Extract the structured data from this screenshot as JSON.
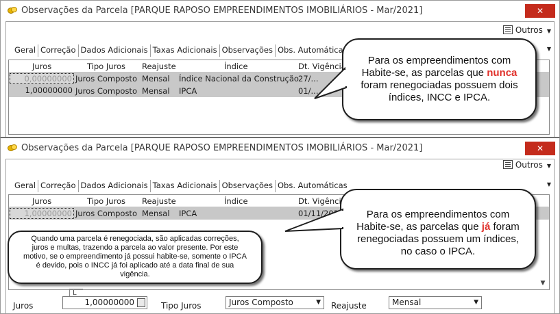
{
  "window1": {
    "title": "Observações da Parcela [PARQUE RAPOSO EMPREENDIMENTOS IMOBILIÁRIOS - Mar/2021]",
    "close_label": "✕",
    "outros_label": "Outros",
    "tabs": [
      "Geral",
      "Correção",
      "Dados Adicionais",
      "Taxas Adicionais",
      "Observações",
      "Obs. Automáticas"
    ],
    "active_tab": "Correção",
    "columns": [
      "Juros",
      "Tipo Juros",
      "Reajuste",
      "Índice",
      "Dt. Vigência"
    ],
    "rows": [
      {
        "juros": "0,00000000",
        "tipo_juros": "Juros Composto",
        "reajuste": "Mensal",
        "indice": "Índice Nacional da Construção",
        "vigencia": "27/..."
      },
      {
        "juros": "1,00000000",
        "tipo_juros": "Juros Composto",
        "reajuste": "Mensal",
        "indice": "IPCA",
        "vigencia": "01/..."
      }
    ]
  },
  "window2": {
    "title": "Observações da Parcela [PARQUE RAPOSO EMPREENDIMENTOS IMOBILIÁRIOS - Mar/2021]",
    "close_label": "✕",
    "outros_label": "Outros",
    "tabs": [
      "Geral",
      "Correção",
      "Dados Adicionais",
      "Taxas Adicionais",
      "Observações",
      "Obs. Automáticas"
    ],
    "active_tab": "Correção",
    "columns": [
      "Juros",
      "Tipo Juros",
      "Reajuste",
      "Índice",
      "Dt. Vigência"
    ],
    "rows": [
      {
        "juros": "1,00000000",
        "tipo_juros": "Juros Composto",
        "reajuste": "Mensal",
        "indice": "IPCA",
        "vigencia": "01/11/2020"
      }
    ],
    "form": {
      "juros_label": "Juros",
      "juros_value": "1,00000000",
      "tipo_juros_label": "Tipo Juros",
      "tipo_juros_value": "Juros Composto",
      "reajuste_label": "Reajuste",
      "reajuste_value": "Mensal"
    },
    "small_label": "L"
  },
  "bubbles": {
    "top": {
      "pre": "Para os empreendimentos com Habite-se, as parcelas que ",
      "highlight": "nunca",
      "post": " foram renegociadas possuem dois índices, INCC e IPCA."
    },
    "mid": {
      "pre": "Para os empreendimentos com Habite-se, as parcelas que ",
      "highlight": "já",
      "post": " foram renegociadas possuem um índices, no caso o IPCA."
    },
    "left": {
      "text": "Quando uma parcela é renegociada, são aplicadas correções, juros e multas, trazendo a parcela ao valor presente. Por este motivo, se o empreendimento já possui habite-se, somente o IPCA é devido, pois o INCC já foi aplicado até a data final de sua vigência."
    }
  },
  "colors": {
    "highlight": "#e0302a",
    "close_button": "#c42b1c",
    "selected_row": "#c8c8c8"
  }
}
